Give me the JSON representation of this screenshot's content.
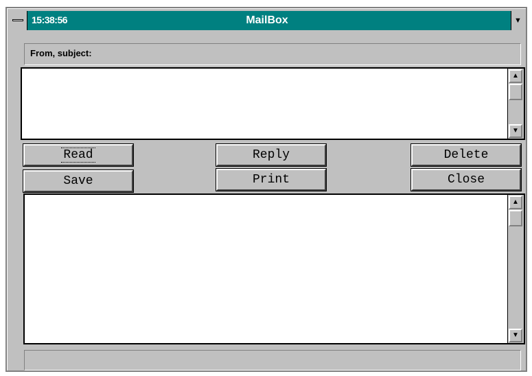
{
  "window": {
    "clock": "15:38:56",
    "title": "MailBox",
    "dropdown_icon": "▼"
  },
  "header": {
    "from_subject_label": "From, subject:"
  },
  "buttons": {
    "read": "Read",
    "reply": "Reply",
    "delete": "Delete",
    "save": "Save",
    "print": "Print",
    "close": "Close"
  },
  "scroll": {
    "up_icon": "▲",
    "down_icon": "▼"
  },
  "colors": {
    "titlebar": "#008080",
    "window_face": "#c0c0c0"
  }
}
